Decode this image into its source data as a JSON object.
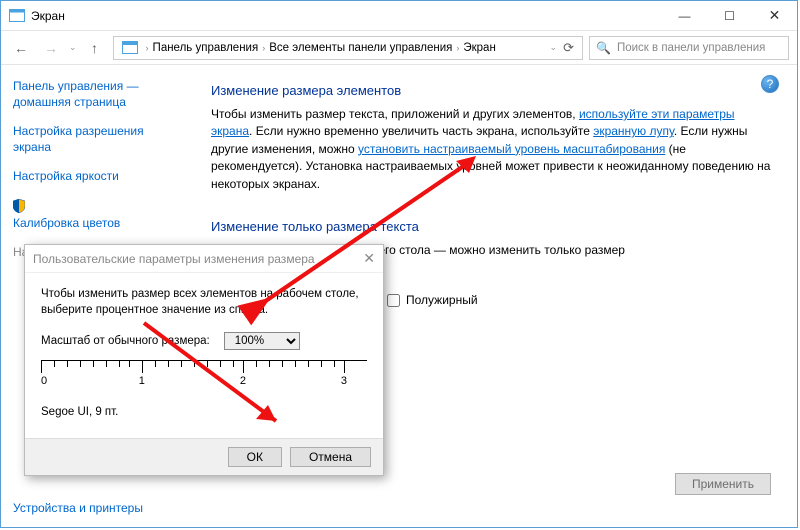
{
  "window": {
    "title": "Экран"
  },
  "nav": {
    "breadcrumbs": [
      "Панель управления",
      "Все элементы панели управления",
      "Экран"
    ],
    "search_placeholder": "Поиск в панели управления"
  },
  "sidebar": {
    "items": [
      "Панель управления — домашняя страница",
      "Настройка разрешения экрана",
      "Настройка яркости",
      "Калибровка цветов",
      "Настройка параметров"
    ]
  },
  "main": {
    "h1": "Изменение размера элементов",
    "p1_a": "Чтобы изменить размер текста, приложений и других элементов, ",
    "p1_link": "используйте эти параметры экрана",
    "p1_b": ". Если нужно временно увеличить часть экрана, используйте ",
    "p1_link2": "экранную лупу",
    "p1_c": ". Если нужны другие изменения, можно ",
    "p1_link3": "установить настраиваемый уровень масштабирования",
    "p1_d": " (не рекомендуется). Установка настраиваемых уровней может привести к неожиданному поведению на некоторых экранах.",
    "h2": "Изменение только размера текста",
    "p2": "размер всех элементов рабочего стола — можно изменить только размер",
    "checkbox_label": "Полужирный",
    "apply": "Применить"
  },
  "see_also": {
    "label": "Устройства и принтеры"
  },
  "dialog": {
    "title": "Пользовательские параметры изменения размера",
    "intro": "Чтобы изменить размер всех элементов на рабочем столе, выберите процентное значение из списка.",
    "scale_label": "Масштаб от обычного размера:",
    "scale_value": "100%",
    "ruler_labels": [
      "0",
      "1",
      "2",
      "3"
    ],
    "font_sample": "Segoe UI, 9 пт.",
    "ok": "ОК",
    "cancel": "Отмена"
  }
}
